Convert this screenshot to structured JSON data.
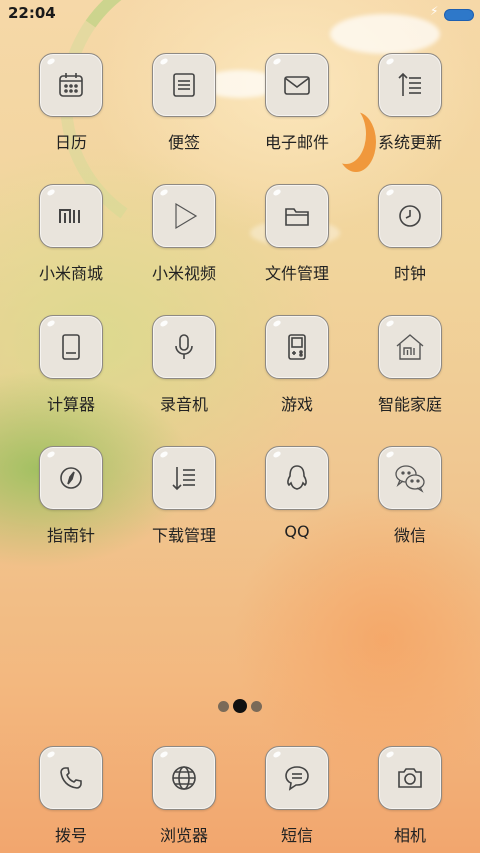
{
  "status_bar": {
    "time": "22:04"
  },
  "apps": [
    {
      "label": "日历",
      "icon": "calendar-icon"
    },
    {
      "label": "便签",
      "icon": "notes-icon"
    },
    {
      "label": "电子邮件",
      "icon": "mail-icon"
    },
    {
      "label": "系统更新",
      "icon": "update-icon"
    },
    {
      "label": "小米商城",
      "icon": "mi-store-icon"
    },
    {
      "label": "小米视频",
      "icon": "video-play-icon"
    },
    {
      "label": "文件管理",
      "icon": "folder-icon"
    },
    {
      "label": "时钟",
      "icon": "clock-icon"
    },
    {
      "label": "计算器",
      "icon": "calculator-icon"
    },
    {
      "label": "录音机",
      "icon": "microphone-icon"
    },
    {
      "label": "游戏",
      "icon": "gamepad-icon"
    },
    {
      "label": "智能家庭",
      "icon": "mi-home-icon"
    },
    {
      "label": "指南针",
      "icon": "compass-icon"
    },
    {
      "label": "下载管理",
      "icon": "download-icon"
    },
    {
      "label": "QQ",
      "icon": "qq-penguin-icon"
    },
    {
      "label": "微信",
      "icon": "wechat-icon"
    }
  ],
  "page_indicator": {
    "pages": 3,
    "current": 2
  },
  "dock": [
    {
      "label": "拨号",
      "icon": "phone-icon"
    },
    {
      "label": "浏览器",
      "icon": "globe-icon"
    },
    {
      "label": "短信",
      "icon": "message-icon"
    },
    {
      "label": "相机",
      "icon": "camera-icon"
    }
  ]
}
